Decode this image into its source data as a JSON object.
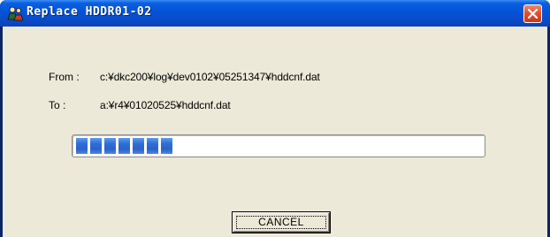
{
  "window": {
    "title": "Replace  HDDR01-02",
    "app_icon": "people-icon",
    "close_icon": "close-icon"
  },
  "transfer": {
    "from_label": "From :",
    "from_value": "c:¥dkc200¥log¥dev0102¥05251347¥hddcnf.dat",
    "to_label": "To :",
    "to_value": "a:¥r4¥01020525¥hddcnf.dat"
  },
  "progress": {
    "filled_segments": 7,
    "fraction": 0.25,
    "color": "#2c6ed8"
  },
  "buttons": {
    "cancel_label": "CANCEL"
  },
  "colors": {
    "titlebar": "#0453d6",
    "client_bg": "#ece9d8",
    "close_button": "#e2502c"
  }
}
